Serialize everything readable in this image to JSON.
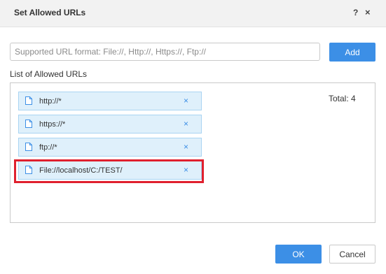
{
  "dialog": {
    "title": "Set Allowed URLs",
    "help_glyph": "?",
    "close_glyph": "×"
  },
  "url_input": {
    "value": "",
    "placeholder": "Supported URL format: File://, Http://, Https://, Ftp://"
  },
  "add_button": {
    "label": "Add"
  },
  "list": {
    "label": "List of Allowed URLs",
    "total_text": "Total: 4",
    "remove_glyph": "×",
    "items": [
      {
        "url": "http://*"
      },
      {
        "url": "https://*"
      },
      {
        "url": "ftp://*"
      },
      {
        "url": "File://localhost/C:/TEST/",
        "highlighted": true
      }
    ]
  },
  "footer": {
    "ok_label": "OK",
    "cancel_label": "Cancel"
  },
  "colors": {
    "accent": "#3c8fe6",
    "item_background": "#dff0fb",
    "item_border": "#a9d4f2",
    "highlight_border": "#e0202e"
  },
  "icons": {
    "file": "file-icon",
    "remove": "remove-icon",
    "help": "help-icon",
    "close": "close-icon"
  }
}
